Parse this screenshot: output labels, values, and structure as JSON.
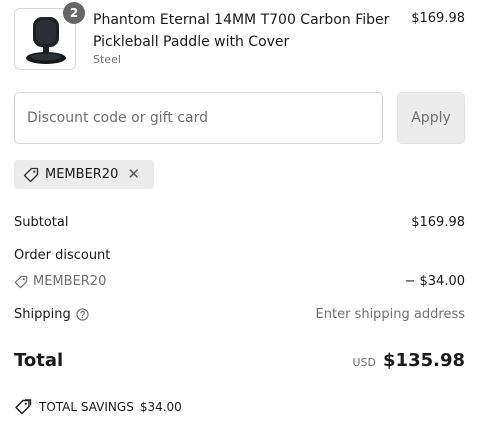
{
  "product": {
    "quantity": "2",
    "name_line1": "Phantom Eternal 14MM T700 Carbon Fiber",
    "name_line2": "Pickleball Paddle with Cover",
    "variant": "Steel",
    "price": "$169.98",
    "image_icon": "paddle-image"
  },
  "discount_form": {
    "placeholder": "Discount code or gift card",
    "value": "",
    "apply_label": "Apply"
  },
  "applied_code": {
    "label": "MEMBER20",
    "tag_icon": "tag-icon",
    "remove_icon": "close-icon",
    "remove_glyph": "✕"
  },
  "summary": {
    "subtotal_label": "Subtotal",
    "subtotal_value": "$169.98",
    "order_discount_label": "Order discount",
    "order_discount_code": "MEMBER20",
    "order_discount_value": "− $34.00",
    "shipping_label": "Shipping",
    "shipping_value": "Enter shipping address",
    "total_label": "Total",
    "currency": "USD",
    "total_value": "$135.98",
    "savings_label": "TOTAL SAVINGS",
    "savings_value": "$34.00"
  },
  "colors": {
    "text": "#1a1a1a",
    "muted": "#707070",
    "field_border": "#d6d6d6",
    "button_bg": "#ececec",
    "badge_bg": "#666666"
  }
}
